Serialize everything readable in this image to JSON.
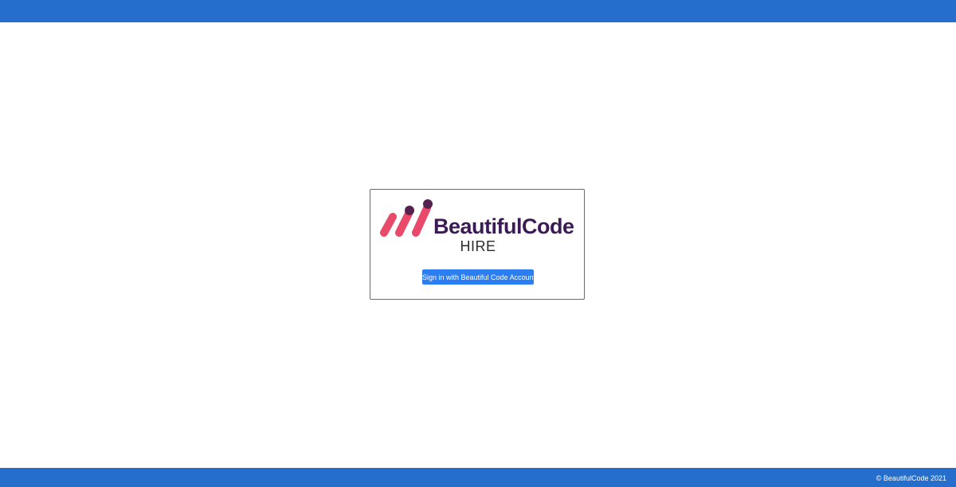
{
  "logo": {
    "wordmark": "BeautifulCode",
    "product": "HIRE",
    "icon": "beautifulcode-bars-icon",
    "colors": {
      "bar_pink": "#ea4a6a",
      "dot_purple": "#55214f",
      "wordmark": "#3b1a56"
    }
  },
  "login": {
    "signin_label": "Sign in with Beautiful Code Account",
    "button_color": "#2b7df2"
  },
  "footer": {
    "copyright": "© BeautifulCode 2021"
  },
  "theme": {
    "header_color": "#256ecb",
    "footer_color": "#256ecb"
  }
}
